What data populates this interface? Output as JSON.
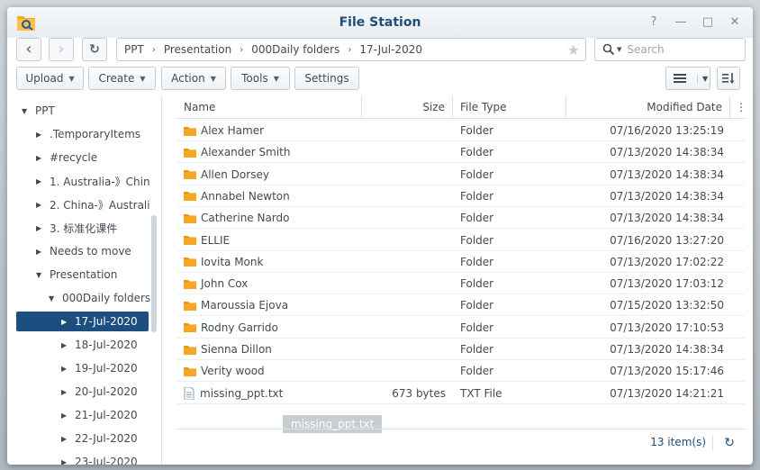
{
  "window": {
    "title": "File Station",
    "controls": {
      "help": "?",
      "minimize": "—",
      "maximize": "□",
      "close": "✕"
    }
  },
  "nav": {
    "back_icon": "‹",
    "forward_icon": "›",
    "refresh_icon": "↻",
    "breadcrumb": [
      "PPT",
      "Presentation",
      "000Daily folders",
      "17-Jul-2020"
    ],
    "crumb_sep": "›",
    "search_placeholder": "Search"
  },
  "toolbar": {
    "upload": "Upload",
    "create": "Create",
    "action": "Action",
    "tools": "Tools",
    "settings": "Settings"
  },
  "sidebar": {
    "items": [
      {
        "label": "PPT",
        "arrow": "▼"
      },
      {
        "label": ".TemporaryItems",
        "arrow": "▶"
      },
      {
        "label": "#recycle",
        "arrow": "▶"
      },
      {
        "label": "1. Australia-》Chin",
        "arrow": "▶"
      },
      {
        "label": "2. China-》Australi",
        "arrow": "▶"
      },
      {
        "label": "3. 标准化课件",
        "arrow": "▶"
      },
      {
        "label": "Needs to move",
        "arrow": "▶"
      },
      {
        "label": "Presentation",
        "arrow": "▼"
      },
      {
        "label": "000Daily folders",
        "arrow": "▼"
      },
      {
        "label": "17-Jul-2020",
        "arrow": "▶"
      },
      {
        "label": "18-Jul-2020",
        "arrow": "▶"
      },
      {
        "label": "19-Jul-2020",
        "arrow": "▶"
      },
      {
        "label": "20-Jul-2020",
        "arrow": "▶"
      },
      {
        "label": "21-Jul-2020",
        "arrow": "▶"
      },
      {
        "label": "22-Jul-2020",
        "arrow": "▶"
      },
      {
        "label": "23-Jul-2020",
        "arrow": "▶"
      }
    ]
  },
  "columns": {
    "name": "Name",
    "size": "Size",
    "type": "File Type",
    "modified": "Modified Date",
    "menu": "⋮"
  },
  "files": [
    {
      "name": "Alex Hamer",
      "size": "",
      "type": "Folder",
      "modified": "07/16/2020 13:25:19"
    },
    {
      "name": "Alexander Smith",
      "size": "",
      "type": "Folder",
      "modified": "07/13/2020 14:38:34"
    },
    {
      "name": "Allen Dorsey",
      "size": "",
      "type": "Folder",
      "modified": "07/13/2020 14:38:34"
    },
    {
      "name": "Annabel Newton",
      "size": "",
      "type": "Folder",
      "modified": "07/13/2020 14:38:34"
    },
    {
      "name": "Catherine Nardo",
      "size": "",
      "type": "Folder",
      "modified": "07/13/2020 14:38:34"
    },
    {
      "name": "ELLIE",
      "size": "",
      "type": "Folder",
      "modified": "07/16/2020 13:27:20"
    },
    {
      "name": "Iovita Monk",
      "size": "",
      "type": "Folder",
      "modified": "07/13/2020 17:02:22"
    },
    {
      "name": "John Cox",
      "size": "",
      "type": "Folder",
      "modified": "07/13/2020 17:03:12"
    },
    {
      "name": "Maroussia Ejova",
      "size": "",
      "type": "Folder",
      "modified": "07/15/2020 13:32:50"
    },
    {
      "name": "Rodny Garrido",
      "size": "",
      "type": "Folder",
      "modified": "07/13/2020 17:10:53"
    },
    {
      "name": "Sienna Dillon",
      "size": "",
      "type": "Folder",
      "modified": "07/13/2020 14:38:34"
    },
    {
      "name": "Verity wood",
      "size": "",
      "type": "Folder",
      "modified": "07/13/2020 15:17:46"
    },
    {
      "name": "missing_ppt.txt",
      "size": "673 bytes",
      "type": "TXT File",
      "modified": "07/13/2020 14:21:21"
    }
  ],
  "tooltip": "missing_ppt.txt",
  "status": {
    "count": "13 item(s)",
    "refresh_icon": "↻"
  },
  "colors": {
    "accent": "#1c4f80",
    "folder": "#f5a623",
    "title": "#1f4e79"
  }
}
